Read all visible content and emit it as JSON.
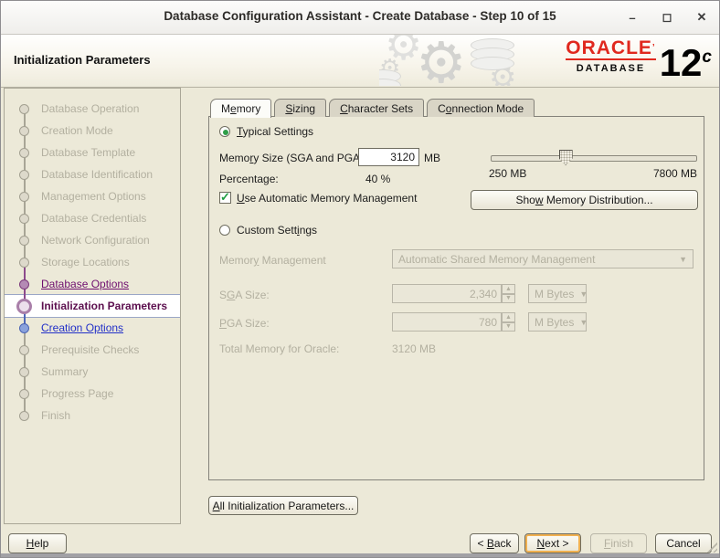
{
  "window": {
    "title": "Database Configuration Assistant - Create Database - Step 10 of 15",
    "controls": {
      "minimize": "–",
      "maximize": "◻",
      "close": "✕"
    }
  },
  "header": {
    "title": "Initialization Parameters",
    "logo": {
      "brand": "ORACLE",
      "mark": "’",
      "product": "DATABASE",
      "version": "12",
      "version_suffix": "c"
    }
  },
  "sidebar": {
    "steps": [
      {
        "label": "Database Operation",
        "state": "pending",
        "line": "none"
      },
      {
        "label": "Creation Mode",
        "state": "pending",
        "line": "gray"
      },
      {
        "label": "Database Template",
        "state": "pending",
        "line": "gray"
      },
      {
        "label": "Database Identification",
        "state": "pending",
        "line": "gray"
      },
      {
        "label": "Management Options",
        "state": "pending",
        "line": "gray"
      },
      {
        "label": "Database Credentials",
        "state": "pending",
        "line": "gray"
      },
      {
        "label": "Network Configuration",
        "state": "pending",
        "line": "gray"
      },
      {
        "label": "Storage Locations",
        "state": "pending",
        "line": "gray"
      },
      {
        "label": "Database Options",
        "state": "visited",
        "line": "purple"
      },
      {
        "label": "Initialization Parameters",
        "state": "current",
        "line": "purple"
      },
      {
        "label": "Creation Options",
        "state": "next",
        "line": "blue"
      },
      {
        "label": "Prerequisite Checks",
        "state": "pending",
        "line": "gray"
      },
      {
        "label": "Summary",
        "state": "pending",
        "line": "gray"
      },
      {
        "label": "Progress Page",
        "state": "pending",
        "line": "gray"
      },
      {
        "label": "Finish",
        "state": "pending",
        "line": "gray"
      }
    ]
  },
  "tabs": [
    {
      "id": "memory",
      "pre": "M",
      "key": "e",
      "post": "mory",
      "active": true
    },
    {
      "id": "sizing",
      "pre": "",
      "key": "S",
      "post": "izing",
      "active": false
    },
    {
      "id": "character-sets",
      "pre": "",
      "key": "C",
      "post": "haracter Sets",
      "active": false
    },
    {
      "id": "connection-mode",
      "pre": "C",
      "key": "o",
      "post": "nnection Mode",
      "active": false
    }
  ],
  "memory_tab": {
    "typical_radio": {
      "pre": "",
      "key": "T",
      "post": "ypical Settings",
      "selected": true
    },
    "memory_size": {
      "label_pre": "Memo",
      "label_key": "r",
      "label_post": "y Size (SGA and PGA):",
      "value": "3120",
      "unit": "MB"
    },
    "percentage": {
      "label": "Percentage:",
      "value": "40 %"
    },
    "slider": {
      "min_label": "250 MB",
      "max_label": "7800 MB",
      "thumb_percent": 36
    },
    "amm_checkbox": {
      "pre": "",
      "key": "U",
      "post": "se Automatic Memory Management",
      "checked": true
    },
    "show_distribution_button": {
      "pre": "Sho",
      "key": "w",
      "post": " Memory Distribution..."
    },
    "custom_radio": {
      "pre": "Custom Sett",
      "key": "i",
      "post": "ngs",
      "selected": false
    },
    "memory_management": {
      "label_pre": "Memor",
      "label_key": "y",
      "label_post": " Management",
      "value": "Automatic Shared Memory Management"
    },
    "sga": {
      "label_pre": "S",
      "label_key": "G",
      "label_post": "A Size:",
      "value": "2,340",
      "unit": "M Bytes"
    },
    "pga": {
      "label_pre": "",
      "label_key": "P",
      "label_post": "GA Size:",
      "value": "780",
      "unit": "M Bytes"
    },
    "total": {
      "label": "Total Memory for Oracle:",
      "value": "3120 MB"
    }
  },
  "all_params_button": {
    "pre": "",
    "key": "A",
    "post": "ll Initialization Parameters..."
  },
  "footer": {
    "help": {
      "pre": "",
      "key": "H",
      "post": "elp"
    },
    "back": {
      "pre": "< ",
      "key": "B",
      "post": "ack"
    },
    "next": {
      "pre": "",
      "key": "N",
      "post": "ext >"
    },
    "finish": {
      "pre": "",
      "key": "F",
      "post": "inish",
      "disabled": true
    },
    "cancel": {
      "label": "Cancel"
    }
  },
  "colors": {
    "oracle_red": "#e0281e",
    "link_purple": "#6e0d6e",
    "link_blue": "#2230c8",
    "current_step_text": "#5c0f4e",
    "default_button_ring": "#f0b050",
    "check_green": "#1f9d42",
    "background_beige": "#ece9d8"
  }
}
